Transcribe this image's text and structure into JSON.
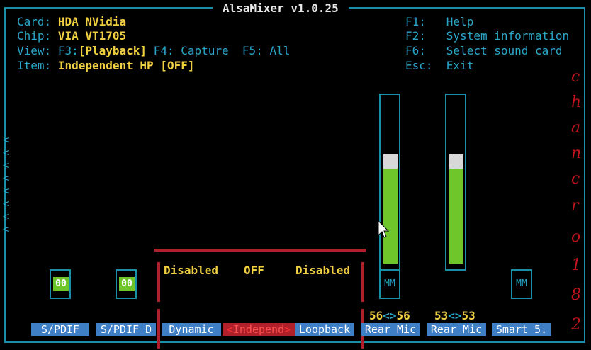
{
  "app": {
    "title": "AlsaMixer v1.0.25"
  },
  "info": {
    "card_label": "Card:",
    "card_value": "HDA NVidia",
    "chip_label": "Chip:",
    "chip_value": "VIA VT1705",
    "view_label": "View:",
    "view_f3": "F3:",
    "view_playback": "[Playback]",
    "view_f4": "F4: Capture",
    "view_f5": "F5: All",
    "item_label": "Item:",
    "item_value": "Independent HP [OFF]"
  },
  "help": {
    "f1": "F1:   Help",
    "f2": "F2:   System information",
    "f6": "F6:   Select sound card",
    "esc": "Esc:  Exit"
  },
  "controls": {
    "spdif_value": "00",
    "spdif_d_value": "00",
    "dynamic_value": "Disabled",
    "independ_value": "OFF",
    "loopback_value": "Disabled",
    "rear_mic1_mute": "MM",
    "rear_mic1_balance_l": "56",
    "rear_mic1_balance_r": "56",
    "rear_mic1_level": 0.66,
    "rear_mic2_balance_l": "53",
    "rear_mic2_balance_r": "53",
    "rear_mic2_level": 0.66,
    "smart_mute": "MM",
    "balance_sep": "<>"
  },
  "channels": {
    "spdif": "S/PDIF",
    "spdif_d": "S/PDIF D",
    "dynamic": "Dynamic",
    "independ": "Independ",
    "loopback": "Loopback",
    "rear_mic1": "Rear Mic",
    "rear_mic2": "Rear Mic",
    "smart": "Smart 5."
  },
  "markers": {
    "left": "<",
    "right": ">"
  },
  "decor": {
    "chars": [
      "c",
      "h",
      "a",
      "n",
      "c",
      "r",
      "o",
      "1",
      "8",
      "2"
    ]
  },
  "colors": {
    "accent": "#2aa6c9",
    "value": "#f0d040",
    "level": "#6ec62a",
    "selected": "#b0202a"
  }
}
